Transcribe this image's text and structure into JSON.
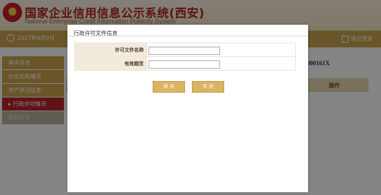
{
  "header": {
    "title": "国家企业信用信息公示系统(西安)",
    "subtitle": "National Enterprise Credit Information Publicity System"
  },
  "nav": {
    "date_text": "2017年8月9日",
    "logout_label": "退出登录"
  },
  "sidebar": {
    "items": [
      {
        "label": "基本信息"
      },
      {
        "label": "分支机构情况"
      },
      {
        "label": "资产状况信息"
      },
      {
        "label": "行政许可情况",
        "active": true
      },
      {
        "label": "即时公示"
      }
    ]
  },
  "background": {
    "reg_no_fragment": "000161X",
    "table_header_operation": "操作"
  },
  "modal": {
    "title": "行政许可文件信息",
    "fields": [
      {
        "label": "许可文件名称",
        "value": ""
      },
      {
        "label": "有效期至",
        "value": ""
      }
    ],
    "save_label": "保 存",
    "close_label": "关 闭"
  },
  "colors": {
    "brand_gold": "#c9a44e",
    "active_red": "#b8262c",
    "title_red": "#b0232a",
    "button_gold": "#d9b463"
  }
}
